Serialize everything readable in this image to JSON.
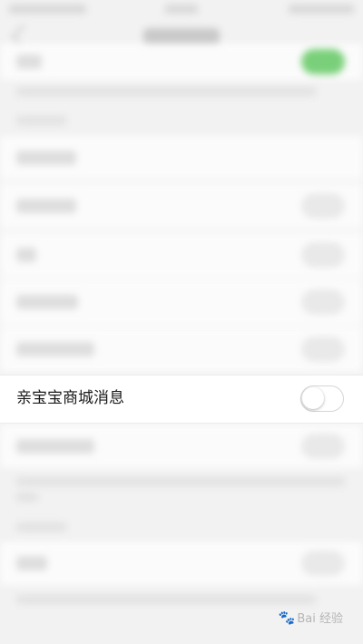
{
  "setting_row": {
    "label": "亲宝宝商城消息",
    "toggle_on": false
  },
  "watermark": {
    "icon": "paw-icon",
    "text": "Bai 经验"
  }
}
